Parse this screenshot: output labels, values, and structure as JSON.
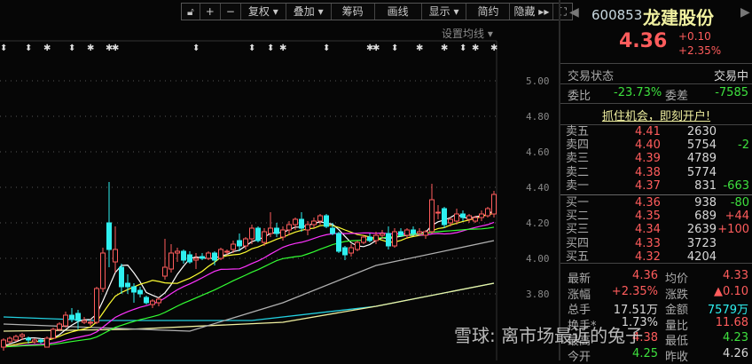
{
  "toolbar": {
    "buttons": [
      "+",
      "−",
      "复权 ▾",
      "叠加 ▾",
      "筹码",
      "画线",
      "显示 ▾",
      "简约",
      "隐藏 ▸▸"
    ],
    "lock_icon": "unlock-icon",
    "fullscreen_icon": "fullscreen-icon"
  },
  "ma_settings": "设置均线 ▾",
  "price_axis": [
    "5.00",
    "4.80",
    "4.60",
    "4.40",
    "4.20",
    "4.00",
    "3.80"
  ],
  "colors": {
    "up": "#ff5c5c",
    "down": "#2ef0f0",
    "ma5": "#ffffff",
    "ma10": "#ffff33",
    "ma20": "#ff33ff",
    "ma30": "#33ff33"
  },
  "candles": [
    [
      3.5,
      3.55,
      3.48,
      3.54
    ],
    [
      3.53,
      3.56,
      3.52,
      3.55
    ],
    [
      3.54,
      3.57,
      3.53,
      3.56
    ],
    [
      3.56,
      3.58,
      3.54,
      3.57
    ],
    [
      3.55,
      3.56,
      3.52,
      3.54
    ],
    [
      3.53,
      3.55,
      3.52,
      3.54
    ],
    [
      3.54,
      3.55,
      3.52,
      3.53
    ],
    [
      3.5,
      3.56,
      3.5,
      3.55
    ],
    [
      3.55,
      3.61,
      3.55,
      3.6
    ],
    [
      3.6,
      3.64,
      3.59,
      3.63
    ],
    [
      3.62,
      3.7,
      3.61,
      3.68
    ],
    [
      3.68,
      3.72,
      3.64,
      3.66
    ],
    [
      3.69,
      3.71,
      3.6,
      3.65
    ],
    [
      3.64,
      3.67,
      3.63,
      3.65
    ],
    [
      3.64,
      3.66,
      3.62,
      3.64
    ],
    [
      3.64,
      3.84,
      3.63,
      3.83
    ],
    [
      3.83,
      4.06,
      3.81,
      4.03
    ],
    [
      4.2,
      4.43,
      3.95,
      4.05
    ],
    [
      3.98,
      4.18,
      3.92,
      4.05
    ],
    [
      3.95,
      3.97,
      3.8,
      3.84
    ],
    [
      3.86,
      3.91,
      3.8,
      3.84
    ],
    [
      3.84,
      3.86,
      3.75,
      3.81
    ],
    [
      3.82,
      3.84,
      3.78,
      3.8
    ],
    [
      3.78,
      3.79,
      3.74,
      3.75
    ],
    [
      3.74,
      3.77,
      3.72,
      3.76
    ],
    [
      3.75,
      3.78,
      3.73,
      3.77
    ],
    [
      3.9,
      4.11,
      3.88,
      3.95
    ],
    [
      3.94,
      4.08,
      3.92,
      4.03
    ],
    [
      4.03,
      4.06,
      3.98,
      4.04
    ],
    [
      4.04,
      4.05,
      3.97,
      3.99
    ],
    [
      4.02,
      4.04,
      3.97,
      3.98
    ],
    [
      3.99,
      4.03,
      3.94,
      4.0
    ],
    [
      4.01,
      4.03,
      3.99,
      4.0
    ],
    [
      4.0,
      4.04,
      3.99,
      4.03
    ],
    [
      4.03,
      4.04,
      3.96,
      3.99
    ],
    [
      4.0,
      4.06,
      3.99,
      4.05
    ],
    [
      4.04,
      4.05,
      4.02,
      4.04
    ],
    [
      4.05,
      4.1,
      4.03,
      4.08
    ],
    [
      4.1,
      4.14,
      4.04,
      4.07
    ],
    [
      4.07,
      4.12,
      4.05,
      4.11
    ],
    [
      4.11,
      4.19,
      4.08,
      4.17
    ],
    [
      4.17,
      4.18,
      4.09,
      4.1
    ],
    [
      4.09,
      4.17,
      4.07,
      4.15
    ],
    [
      4.14,
      4.26,
      4.12,
      4.17
    ],
    [
      4.17,
      4.2,
      4.12,
      4.14
    ],
    [
      4.12,
      4.18,
      4.1,
      4.16
    ],
    [
      4.16,
      4.21,
      4.13,
      4.19
    ],
    [
      4.19,
      4.23,
      4.16,
      4.22
    ],
    [
      4.22,
      4.26,
      4.15,
      4.17
    ],
    [
      4.16,
      4.21,
      4.13,
      4.19
    ],
    [
      4.19,
      4.23,
      4.17,
      4.21
    ],
    [
      4.21,
      4.25,
      4.19,
      4.24
    ],
    [
      4.24,
      4.25,
      4.17,
      4.18
    ],
    [
      4.17,
      4.2,
      4.13,
      4.14
    ],
    [
      4.14,
      4.15,
      4.03,
      4.04
    ],
    [
      4.06,
      4.07,
      3.99,
      4.02
    ],
    [
      4.03,
      4.08,
      4.01,
      4.06
    ],
    [
      4.05,
      4.1,
      4.04,
      4.09
    ],
    [
      4.09,
      4.13,
      4.08,
      4.12
    ],
    [
      4.12,
      4.14,
      4.09,
      4.1
    ],
    [
      4.1,
      4.15,
      4.08,
      4.13
    ],
    [
      4.13,
      4.16,
      4.11,
      4.14
    ],
    [
      4.14,
      4.18,
      4.05,
      4.07
    ],
    [
      4.07,
      4.17,
      4.06,
      4.15
    ],
    [
      4.15,
      4.17,
      4.12,
      4.13
    ],
    [
      4.13,
      4.17,
      4.11,
      4.16
    ],
    [
      4.16,
      4.18,
      4.13,
      4.14
    ],
    [
      4.14,
      4.17,
      4.13,
      4.15
    ],
    [
      4.13,
      4.16,
      4.11,
      4.15
    ],
    [
      4.15,
      4.42,
      4.14,
      4.33
    ],
    [
      4.26,
      4.3,
      4.22,
      4.26
    ],
    [
      4.28,
      4.29,
      4.17,
      4.19
    ],
    [
      4.2,
      4.23,
      4.18,
      4.22
    ],
    [
      4.21,
      4.28,
      4.19,
      4.25
    ],
    [
      4.25,
      4.27,
      4.21,
      4.23
    ],
    [
      4.22,
      4.25,
      4.2,
      4.24
    ],
    [
      4.21,
      4.24,
      4.2,
      4.23
    ],
    [
      4.23,
      4.27,
      4.21,
      4.25
    ],
    [
      4.24,
      4.29,
      4.23,
      4.28
    ],
    [
      4.25,
      4.38,
      4.23,
      4.36
    ]
  ],
  "long_ma": [
    {
      "color": "#22d0e0",
      "points": [
        [
          0,
          3.67
        ],
        [
          15,
          3.65
        ],
        [
          40,
          3.65
        ],
        [
          60,
          3.73
        ],
        [
          79,
          3.86
        ]
      ]
    },
    {
      "color": "#f0f0a0",
      "points": [
        [
          0,
          3.59
        ],
        [
          20,
          3.6
        ],
        [
          45,
          3.64
        ],
        [
          60,
          3.73
        ],
        [
          79,
          3.86
        ]
      ]
    },
    {
      "color": "#b0b0b0",
      "points": [
        [
          0,
          3.63
        ],
        [
          15,
          3.61
        ],
        [
          30,
          3.59
        ],
        [
          45,
          3.75
        ],
        [
          60,
          3.96
        ],
        [
          79,
          4.1
        ]
      ]
    }
  ],
  "markers": [
    {
      "i": 0,
      "t": "⬍"
    },
    {
      "i": 4,
      "t": "⬍"
    },
    {
      "i": 7,
      "t": "✱"
    },
    {
      "i": 11,
      "t": "⬍"
    },
    {
      "i": 14,
      "t": "✱"
    },
    {
      "i": 17,
      "t": "✱"
    },
    {
      "i": 18,
      "t": "✱"
    },
    {
      "i": 31,
      "t": "⬍"
    },
    {
      "i": 40,
      "t": "⬍"
    },
    {
      "i": 43,
      "t": "⬍"
    },
    {
      "i": 45,
      "t": "✱"
    },
    {
      "i": 52,
      "t": "⬍"
    },
    {
      "i": 59,
      "t": "✱"
    },
    {
      "i": 60,
      "t": "✱"
    },
    {
      "i": 63,
      "t": "⬍"
    },
    {
      "i": 67,
      "t": "✱"
    },
    {
      "i": 71,
      "t": "✱"
    },
    {
      "i": 74,
      "t": "⬍"
    },
    {
      "i": 76,
      "t": "✱"
    },
    {
      "i": 79,
      "t": "✱"
    }
  ],
  "quote": {
    "code": "600853",
    "name": "龙建股份",
    "price": "4.36",
    "change": "+0.10",
    "change_pct": "+2.35%"
  },
  "status": {
    "label": "交易状态",
    "value": "交易中"
  },
  "weibi": {
    "label": "委比",
    "value": "-23.73%",
    "diff_label": "委差",
    "diff": "-7585"
  },
  "promo": "抓住机会，即刻开户!",
  "asks": [
    {
      "label": "卖五",
      "price": "4.41",
      "vol": "2630",
      "chg": ""
    },
    {
      "label": "卖四",
      "price": "4.40",
      "vol": "5754",
      "chg": "-2"
    },
    {
      "label": "卖三",
      "price": "4.39",
      "vol": "4789",
      "chg": ""
    },
    {
      "label": "卖二",
      "price": "4.38",
      "vol": "5774",
      "chg": ""
    },
    {
      "label": "卖一",
      "price": "4.37",
      "vol": "831",
      "chg": "-663"
    }
  ],
  "bids": [
    {
      "label": "买一",
      "price": "4.36",
      "vol": "938",
      "chg": "-80"
    },
    {
      "label": "买二",
      "price": "4.35",
      "vol": "689",
      "chg": "+44"
    },
    {
      "label": "买三",
      "price": "4.34",
      "vol": "2639",
      "chg": "+100"
    },
    {
      "label": "买四",
      "price": "4.33",
      "vol": "3723",
      "chg": ""
    },
    {
      "label": "买五",
      "price": "4.32",
      "vol": "4204",
      "chg": ""
    }
  ],
  "stats": [
    {
      "l1": "最新",
      "v1": "4.36",
      "l2": "均价",
      "v2": "4.33"
    },
    {
      "l1": "涨幅",
      "v1": "+2.35%",
      "l2": "涨跌",
      "v2": "▲0.10"
    },
    {
      "l1": "总手",
      "v1": "17.51万",
      "l2": "金额",
      "v2": "7579万"
    },
    {
      "l1": "换手*",
      "v1": "1.73%",
      "l2": "量比",
      "v2": "11.68"
    },
    {
      "l1": "最高",
      "v1": "4.38",
      "l2": "最低",
      "v2": "4.23"
    },
    {
      "l1": "今开",
      "v1": "4.25",
      "l2": "昨收",
      "v2": "4.26"
    }
  ],
  "watermark": "雪球: 离市场最近的兔子"
}
